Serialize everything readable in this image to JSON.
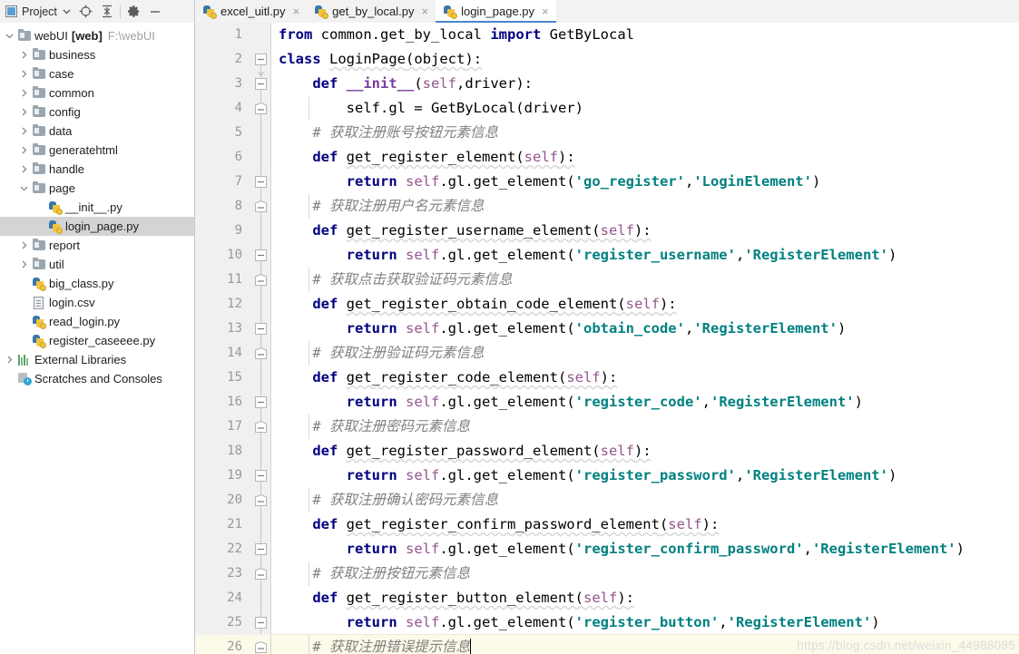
{
  "toolbar": {
    "project_label": "Project",
    "dropdown_icon": "chevron-down-icon",
    "locate_icon": "crosshair-target-icon",
    "collapse_icon": "collapse-all-icon",
    "settings_icon": "gear-icon",
    "hide_icon": "minimize-icon"
  },
  "tabs": [
    {
      "label": "excel_uitl.py",
      "icon": "python-file-icon",
      "close": "×",
      "active": false
    },
    {
      "label": "get_by_local.py",
      "icon": "python-file-icon",
      "close": "×",
      "active": false
    },
    {
      "label": "login_page.py",
      "icon": "python-file-icon",
      "close": "×",
      "active": true
    }
  ],
  "sidebar": {
    "items": [
      {
        "label": "webUI",
        "suffix": "[web]",
        "path": "F:\\webUI",
        "icon": "folder-icon",
        "indent": 0,
        "arrow": "down",
        "selected": false,
        "root": true
      },
      {
        "label": "business",
        "icon": "folder-icon",
        "indent": 1,
        "arrow": "right",
        "selected": false
      },
      {
        "label": "case",
        "icon": "folder-icon",
        "indent": 1,
        "arrow": "right",
        "selected": false
      },
      {
        "label": "common",
        "icon": "folder-icon",
        "indent": 1,
        "arrow": "right",
        "selected": false
      },
      {
        "label": "config",
        "icon": "folder-icon",
        "indent": 1,
        "arrow": "right",
        "selected": false
      },
      {
        "label": "data",
        "icon": "folder-icon",
        "indent": 1,
        "arrow": "right",
        "selected": false
      },
      {
        "label": "generatehtml",
        "icon": "folder-icon",
        "indent": 1,
        "arrow": "right",
        "selected": false
      },
      {
        "label": "handle",
        "icon": "folder-icon",
        "indent": 1,
        "arrow": "right",
        "selected": false
      },
      {
        "label": "page",
        "icon": "folder-icon",
        "indent": 1,
        "arrow": "down",
        "selected": false
      },
      {
        "label": "__init__.py",
        "icon": "python-file-icon",
        "indent": 2,
        "arrow": "none",
        "selected": false
      },
      {
        "label": "login_page.py",
        "icon": "python-file-icon",
        "indent": 2,
        "arrow": "none",
        "selected": true
      },
      {
        "label": "report",
        "icon": "folder-icon",
        "indent": 1,
        "arrow": "right",
        "selected": false
      },
      {
        "label": "util",
        "icon": "folder-icon",
        "indent": 1,
        "arrow": "right",
        "selected": false
      },
      {
        "label": "big_class.py",
        "icon": "python-file-icon",
        "indent": 1,
        "arrow": "none",
        "selected": false
      },
      {
        "label": "login.csv",
        "icon": "csv-file-icon",
        "indent": 1,
        "arrow": "none",
        "selected": false
      },
      {
        "label": "read_login.py",
        "icon": "python-file-icon",
        "indent": 1,
        "arrow": "none",
        "selected": false
      },
      {
        "label": "register_caseeee.py",
        "icon": "python-file-icon",
        "indent": 1,
        "arrow": "none",
        "selected": false
      },
      {
        "label": "External Libraries",
        "icon": "libraries-icon",
        "indent": 0,
        "arrow": "right",
        "selected": false
      },
      {
        "label": "Scratches and Consoles",
        "icon": "scratches-icon",
        "indent": 0,
        "arrow": "none",
        "selected": false
      }
    ]
  },
  "editor": {
    "current_line": 26,
    "line_numbers": [
      1,
      2,
      3,
      4,
      5,
      6,
      7,
      8,
      9,
      10,
      11,
      12,
      13,
      14,
      15,
      16,
      17,
      18,
      19,
      20,
      21,
      22,
      23,
      24,
      25,
      26
    ],
    "lines": [
      {
        "n": 1,
        "text": "from common.get_by_local import GetByLocal"
      },
      {
        "n": 2,
        "text": "class LoginPage(object):"
      },
      {
        "n": 3,
        "text": "    def __init__(self,driver):"
      },
      {
        "n": 4,
        "text": "        self.gl = GetByLocal(driver)"
      },
      {
        "n": 5,
        "text": "    # 获取注册账号按钮元素信息"
      },
      {
        "n": 6,
        "text": "    def get_register_element(self):"
      },
      {
        "n": 7,
        "text": "        return self.gl.get_element('go_register','LoginElement')"
      },
      {
        "n": 8,
        "text": "    # 获取注册用户名元素信息"
      },
      {
        "n": 9,
        "text": "    def get_register_username_element(self):"
      },
      {
        "n": 10,
        "text": "        return self.gl.get_element('register_username','RegisterElement')"
      },
      {
        "n": 11,
        "text": "    # 获取点击获取验证码元素信息"
      },
      {
        "n": 12,
        "text": "    def get_register_obtain_code_element(self):"
      },
      {
        "n": 13,
        "text": "        return self.gl.get_element('obtain_code','RegisterElement')"
      },
      {
        "n": 14,
        "text": "    # 获取注册验证码元素信息"
      },
      {
        "n": 15,
        "text": "    def get_register_code_element(self):"
      },
      {
        "n": 16,
        "text": "        return self.gl.get_element('register_code','RegisterElement')"
      },
      {
        "n": 17,
        "text": "    # 获取注册密码元素信息"
      },
      {
        "n": 18,
        "text": "    def get_register_password_element(self):"
      },
      {
        "n": 19,
        "text": "        return self.gl.get_element('register_password','RegisterElement')"
      },
      {
        "n": 20,
        "text": "    # 获取注册确认密码元素信息"
      },
      {
        "n": 21,
        "text": "    def get_register_confirm_password_element(self):"
      },
      {
        "n": 22,
        "text": "        return self.gl.get_element('register_confirm_password','RegisterElement')"
      },
      {
        "n": 23,
        "text": "    # 获取注册按钮元素信息"
      },
      {
        "n": 24,
        "text": "    def get_register_button_element(self):"
      },
      {
        "n": 25,
        "text": "        return self.gl.get_element('register_button','RegisterElement')"
      },
      {
        "n": 26,
        "text": "    # 获取注册错误提示信息"
      }
    ],
    "comments": {
      "c5": "# 获取注册账号按钮元素信息",
      "c8": "# 获取注册用户名元素信息",
      "c11": "# 获取点击获取验证码元素信息",
      "c14": "# 获取注册验证码元素信息",
      "c17": "# 获取注册密码元素信息",
      "c20": "# 获取注册确认密码元素信息",
      "c23": "# 获取注册按钮元素信息",
      "c26": "# 获取注册错误提示信息"
    },
    "tokens": {
      "kw_from": "from",
      "kw_import": "import",
      "kw_class": "class",
      "kw_def": "def",
      "kw_return": "return",
      "mod_common": "common.get_by_local",
      "cls_getbylocal": "GetByLocal",
      "cls_loginpage": "LoginPage",
      "obj": "object",
      "self": "self",
      "dunder_init": "__init__",
      "driver": "driver",
      "assign_gl": "self.gl = GetByLocal(driver)",
      "call_get_element": "self.gl.get_element",
      "fn_get_register_element": "get_register_element",
      "fn_get_register_username_element": "get_register_username_element",
      "fn_get_register_obtain_code_element": "get_register_obtain_code_element",
      "fn_get_register_code_element": "get_register_code_element",
      "fn_get_register_password_element": "get_register_password_element",
      "fn_get_register_confirm_password_element": "get_register_confirm_password_element",
      "fn_get_register_button_element": "get_register_button_element",
      "s_go_register": "'go_register'",
      "s_login_element": "'LoginElement'",
      "s_register_username": "'register_username'",
      "s_obtain_code": "'obtain_code'",
      "s_register_code": "'register_code'",
      "s_register_password": "'register_password'",
      "s_register_confirm_password": "'register_confirm_password'",
      "s_register_button": "'register_button'",
      "s_register_element": "'RegisterElement'"
    }
  },
  "watermark": "https://blog.csdn.net/weixin_44988085",
  "colors": {
    "keyword": "#000080",
    "string": "#008080",
    "comment": "#808080",
    "self": "#94558d",
    "tab_accent": "#4a86c8",
    "selection": "#d4d4d4",
    "current_line": "#fcfae8"
  }
}
